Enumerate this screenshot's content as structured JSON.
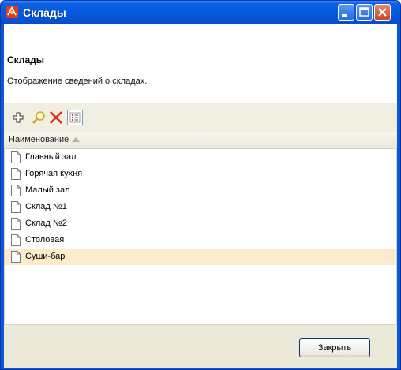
{
  "window": {
    "title": "Склады",
    "colors": {
      "titlebar": "#0658dc",
      "close_button": "#c9461f",
      "selection": "#fdeccb"
    }
  },
  "header": {
    "title": "Склады",
    "description": "Отображение сведений о складах."
  },
  "toolbar": {
    "icons": [
      "plus-icon",
      "search-icon",
      "delete-icon",
      "view-icon"
    ]
  },
  "table": {
    "column_header": "Наименование",
    "sort": "ascending",
    "rows": [
      "Главный зал",
      "Горячая кухня",
      "Малый зал",
      "Склад №1",
      "Склад №2",
      "Столовая",
      "Суши-бар"
    ],
    "selected_index": 6
  },
  "footer": {
    "close_label": "Закрыть"
  }
}
